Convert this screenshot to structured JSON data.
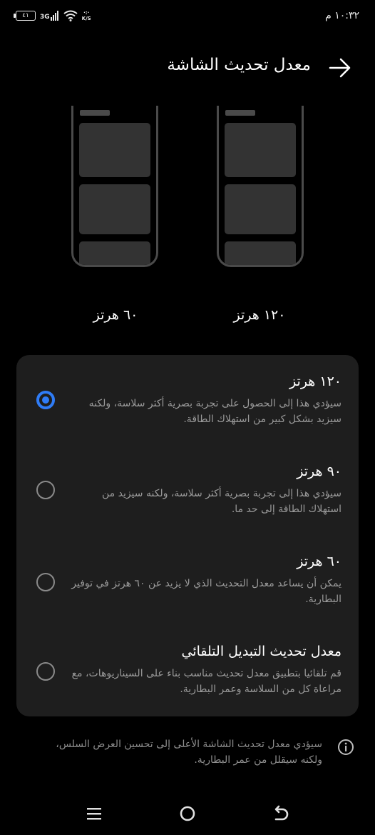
{
  "status_bar": {
    "time": "١٠:٣٢ م",
    "battery": "٤١",
    "network": "3G",
    "speed": "K/S"
  },
  "header": {
    "title": "معدل تحديث الشاشة"
  },
  "illustrations": [
    {
      "label": "١٢٠ هرتز"
    },
    {
      "label": "٦٠ هرتز"
    }
  ],
  "options": [
    {
      "title": "١٢٠ هرتز",
      "description": "سيؤدي هذا إلى الحصول على تجربة بصرية أكثر سلاسة، ولكنه سيزيد بشكل كبير من استهلاك الطاقة.",
      "selected": true
    },
    {
      "title": "٩٠ هرتز",
      "description": "سيؤدي هذا إلى تجربة بصرية أكثر سلاسة، ولكنه سيزيد من استهلاك الطاقة إلى حد ما.",
      "selected": false
    },
    {
      "title": "٦٠ هرتز",
      "description": "يمكن أن يساعد معدل التحديث الذي لا يزيد عن ٦٠ هرتز في توفير البطارية.",
      "selected": false
    },
    {
      "title": "معدل تحديث التبديل التلقائي",
      "description": "قم تلقائيا بتطبيق معدل تحديث مناسب بناء على السيناريوهات، مع مراعاة كل من السلاسة وعمر البطارية.",
      "selected": false
    }
  ],
  "note": {
    "text": "سيؤدي معدل تحديث الشاشة الأعلى إلى تحسين العرض السلس، ولكنه سيقلل من عمر البطارية."
  },
  "colors": {
    "accent": "#2f7cf6",
    "card": "#1e1e1e",
    "background": "#000000"
  }
}
